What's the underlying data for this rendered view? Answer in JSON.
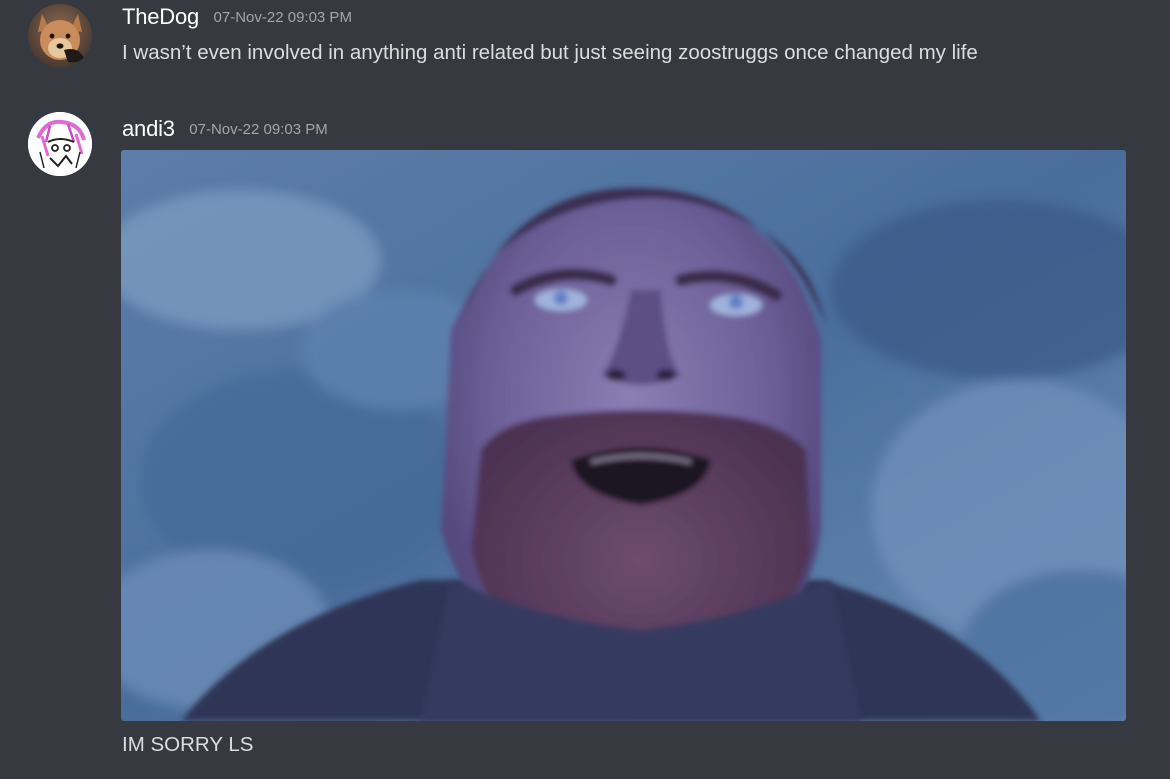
{
  "messages": [
    {
      "username": "TheDog",
      "timestamp": "07-Nov-22 09:03 PM",
      "content": "I wasn’t even involved in anything anti related but just seeing zoostruggs once changed my life",
      "avatar_icon": "dog-avatar-icon"
    },
    {
      "username": "andi3",
      "timestamp": "07-Nov-22 09:03 PM",
      "attachment_icon": "gif-image",
      "caption": "IM SORRY LS",
      "avatar_icon": "anime-sketch-avatar-icon"
    }
  ],
  "colors": {
    "background": "#36393f",
    "username": "#ffffff",
    "timestamp": "#a3a6aa",
    "message_text": "#dcddde"
  }
}
